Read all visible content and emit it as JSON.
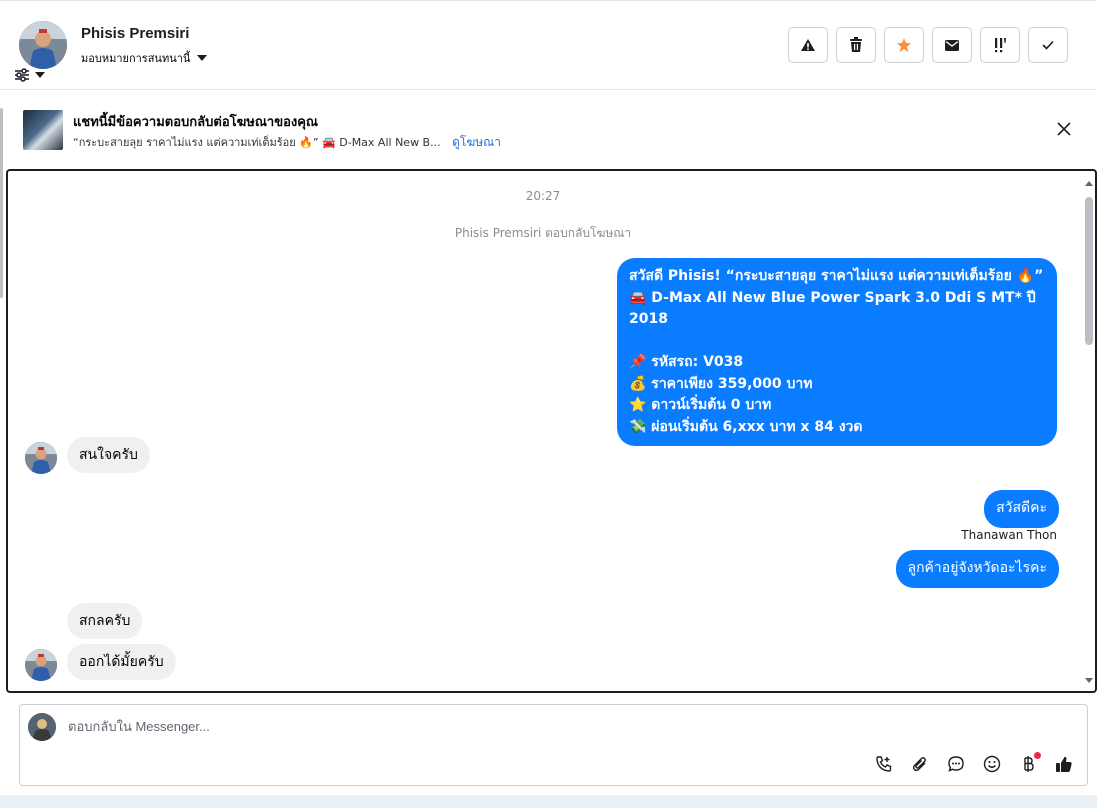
{
  "header": {
    "name": "Phisis Premsiri",
    "assign_label": "มอบหมายการสนทนานี้"
  },
  "actions": [
    {
      "name": "report-spam-button",
      "icon": "warning-icon"
    },
    {
      "name": "delete-button",
      "icon": "trash-icon"
    },
    {
      "name": "star-button",
      "icon": "star-icon",
      "color": "#f7923b"
    },
    {
      "name": "mark-unread-button",
      "icon": "envelope-icon"
    },
    {
      "name": "follow-up-button",
      "icon": "follow-up-icon"
    },
    {
      "name": "mark-done-button",
      "icon": "check-icon"
    }
  ],
  "ad_banner": {
    "title": "แชทนี้มีข้อความตอบกลับต่อโฆษณาของคุณ",
    "subtitle": "“กระบะสายลุย ราคาไม่แรง แต่ความเท่เต็มร้อย 🔥” 🚘 D-Max All New B...",
    "link": "ดูโฆษณา"
  },
  "thread": {
    "time": "20:27",
    "system_note": "Phisis Premsiri ตอบกลับโฆษณา",
    "ad_message": "สวัสดี Phisis! “กระบะสายลุย ราคาไม่แรง แต่ความเท่เต็มร้อย 🔥”\n🚘 D-Max All New Blue Power Spark 3.0 Ddi S MT* ปี 2018\n\n📌 รหัสรถ: V038\n💰 ราคาเพียง 359,000 บาท\n⭐ ดาวน์เริ่มต้น 0 บาท\n💸 ผ่อนเริ่มต้น 6,xxx บาท x 84 งวด",
    "msg_in_1": "สนใจครับ",
    "msg_out_1": "สวัสดีคะ",
    "sender_label": "Thanawan Thon",
    "msg_out_2": "ลูกค้าอยู่จังหวัดอะไรคะ",
    "msg_in_2": "สกลครับ",
    "msg_in_3": "ออกได้มั้ยครับ"
  },
  "composer": {
    "placeholder": "ตอบกลับใน Messenger..."
  },
  "colors": {
    "accent": "#0a7cff",
    "incoming": "#f0f0f0",
    "link": "#216fdb"
  }
}
